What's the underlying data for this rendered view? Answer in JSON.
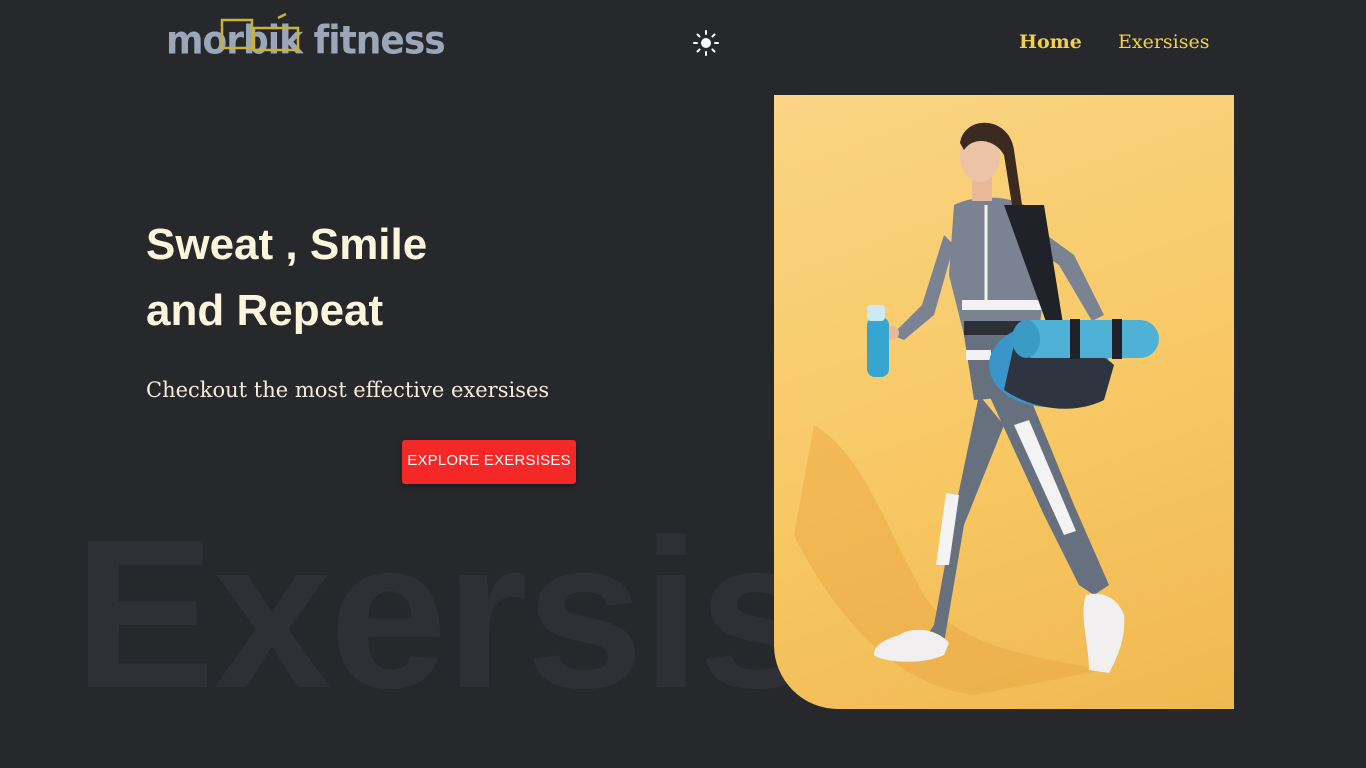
{
  "header": {
    "logo_text": "morbik fitness",
    "theme_toggle_icon": "sun-icon",
    "nav": [
      {
        "label": "Home",
        "active": true
      },
      {
        "label": "Exersises",
        "active": false
      }
    ]
  },
  "hero": {
    "title_line1": "Sweat , Smile",
    "title_line2": "and Repeat",
    "subtitle": "Checkout the most effective exersises",
    "cta_label": "EXPLORE EXERSISES",
    "watermark": "Exersises"
  },
  "colors": {
    "background": "#27282b",
    "accent": "#f2d04b",
    "cta": "#f52828",
    "title": "#fdf6dc",
    "image_bg": "#f7c864"
  }
}
